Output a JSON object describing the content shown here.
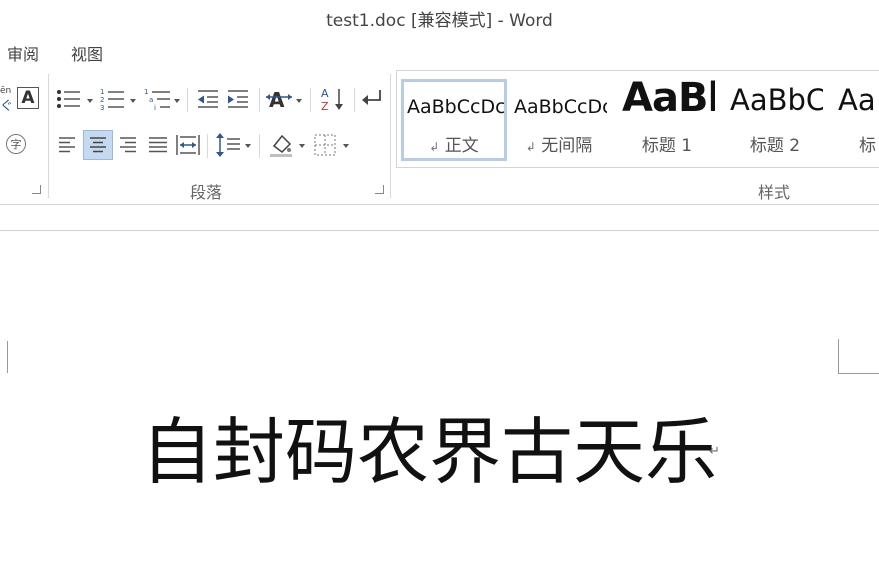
{
  "window": {
    "title": "test1.doc [兼容模式] - Word"
  },
  "menu": {
    "review": "审阅",
    "view": "视图"
  },
  "ribbon": {
    "font_partial": {
      "phonetic_glyph": "ēn",
      "char_border_glyph": "A",
      "enclose_char_glyph": "字",
      "left_arrow": "ぐ"
    },
    "paragraph": {
      "label": "段落",
      "sort_glyph": "A Z"
    },
    "styles": {
      "label": "样式",
      "items": [
        {
          "preview": "AaBbCcDc",
          "name": "正文",
          "mark": "↲"
        },
        {
          "preview": "AaBbCcDc",
          "name": "无间隔",
          "mark": "↲"
        },
        {
          "preview": "AaBl",
          "name": "标题 1"
        },
        {
          "preview": "AaBbC",
          "name": "标题 2"
        },
        {
          "preview": "Aa",
          "name": "标"
        }
      ]
    }
  },
  "document": {
    "text": "自封码农界古天乐",
    "para_mark": "↵"
  }
}
